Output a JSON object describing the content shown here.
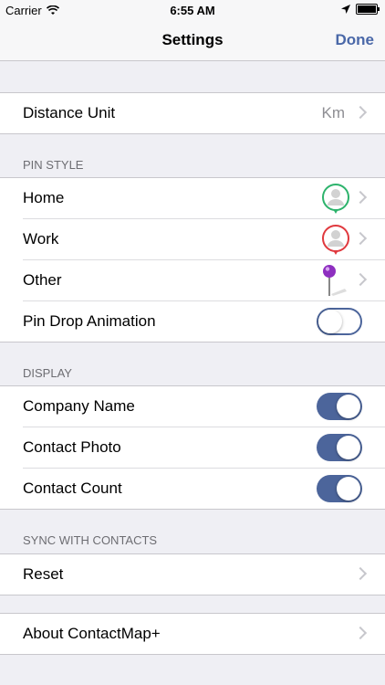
{
  "status_bar": {
    "carrier": "Carrier",
    "time": "6:55 AM"
  },
  "nav": {
    "title": "Settings",
    "done_label": "Done"
  },
  "distance_unit": {
    "label": "Distance Unit",
    "value": "Km"
  },
  "pin_style": {
    "header": "PIN STYLE",
    "home_label": "Home",
    "home_color": "#2db36c",
    "work_label": "Work",
    "work_color": "#e0393e",
    "other_label": "Other",
    "other_color": "#8e2fc0",
    "animation_label": "Pin Drop Animation",
    "animation_on": false
  },
  "display": {
    "header": "DISPLAY",
    "company_name_label": "Company Name",
    "company_name_on": true,
    "contact_photo_label": "Contact Photo",
    "contact_photo_on": true,
    "contact_count_label": "Contact Count",
    "contact_count_on": true
  },
  "sync": {
    "header": "SYNC WITH CONTACTS",
    "reset_label": "Reset"
  },
  "about": {
    "label": "About ContactMap+"
  },
  "colors": {
    "accent": "#4a68a8",
    "toggle_on": "#4c659b",
    "background": "#efeff4"
  }
}
